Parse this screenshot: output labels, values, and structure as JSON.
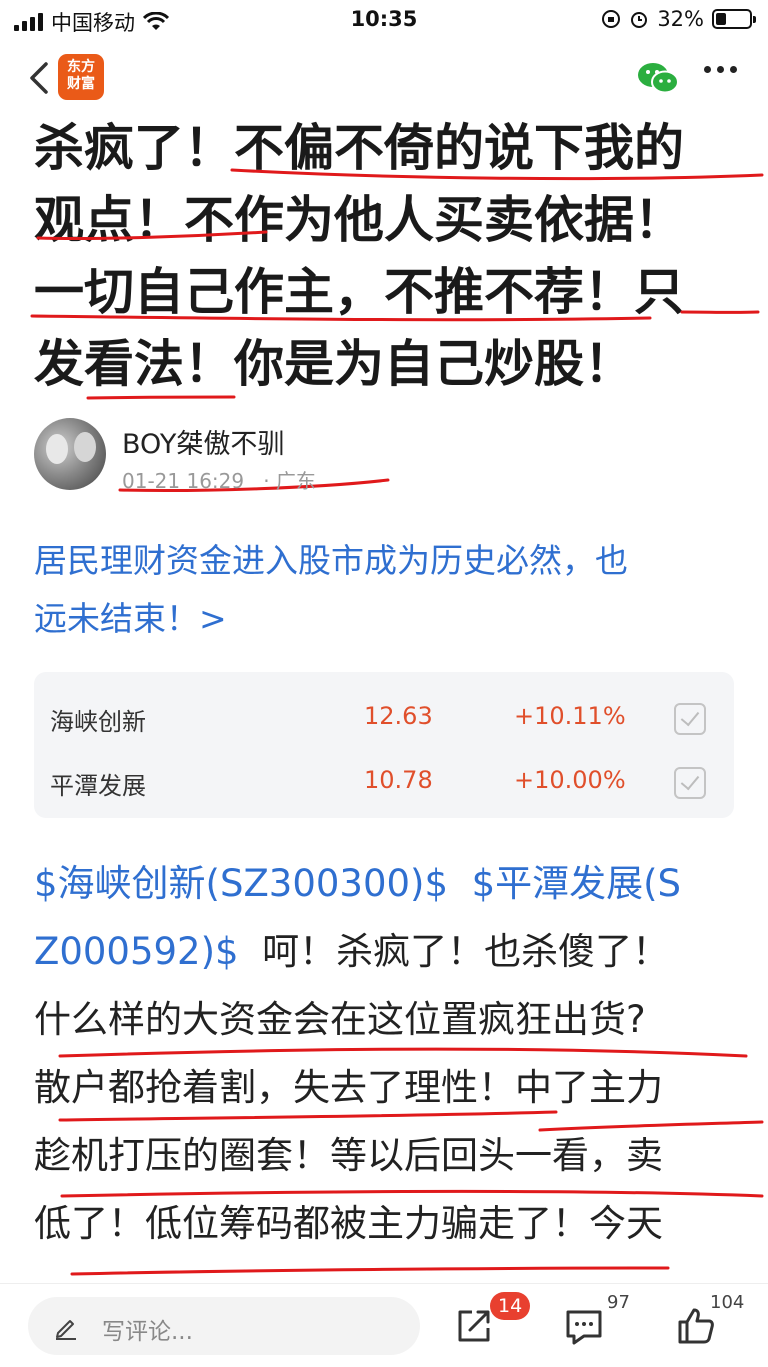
{
  "status_bar": {
    "carrier": "中国移动",
    "time": "10:35",
    "battery": "32%"
  },
  "nav": {
    "logo_line1": "东方",
    "logo_line2": "财富"
  },
  "headline": {
    "lines": [
      "杀疯了！不偏不倚的说下我的",
      "观点！不作为他人买卖依据！",
      "一切自己作主，不推不荐！只",
      "发看法！你是为自己炒股！"
    ],
    "annotation_color": "#e0191b"
  },
  "author": {
    "name": "BOY桀傲不驯",
    "datetime": "01-21 16:29",
    "location": "· 广东"
  },
  "topic": {
    "line1": "居民理财资金进入股市成为历史必然，也",
    "line2": "远未结束！>"
  },
  "stocks": [
    {
      "name": "海峡创新",
      "price": "12.63",
      "change": "+10.11%"
    },
    {
      "name": "平潭发展",
      "price": "10.78",
      "change": "+10.00%"
    }
  ],
  "post": {
    "tag1": "$海峡创新(SZ300300)$",
    "tag2_part1": "$平潭发展(S",
    "tag2_part2": "Z000592)$",
    "line2_rest": "呵！杀疯了！也杀傻了！",
    "line3": "什么样的大资金会在这位置疯狂出货?",
    "line4": "散户都抢着割，失去了理性！中了主力",
    "line5": "趁机打压的圈套！等以后回头一看，卖",
    "line6": "低了！低位筹码都被主力骗走了！今天"
  },
  "bottom_bar": {
    "comment_placeholder": "写评论...",
    "share_badge": "14",
    "comment_count": "97",
    "like_count": "104"
  },
  "colors": {
    "link": "#2f6fd0",
    "price_up": "#e04f2b",
    "logo": "#ea5a18",
    "badge": "#e8402f"
  }
}
